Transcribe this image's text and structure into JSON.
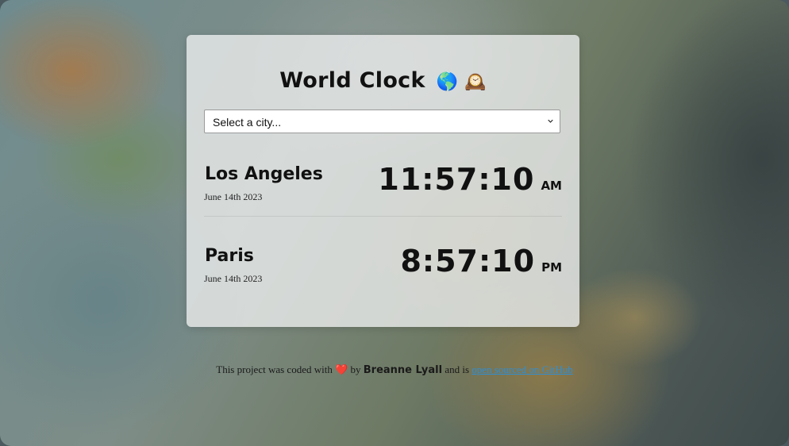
{
  "app": {
    "title": "World Clock",
    "title_emojis": "🌎 🕰️"
  },
  "city_select": {
    "value": "Select a city..."
  },
  "cities": [
    {
      "name": "Los Angeles",
      "date": "June 14th 2023",
      "time": "11:57:10",
      "period": "AM"
    },
    {
      "name": "Paris",
      "date": "June 14th 2023",
      "time": "8:57:10",
      "period": "PM"
    }
  ],
  "footer": {
    "text_before": "This project was coded with",
    "heart": "❤️",
    "by": "by",
    "author": "Breanne Lyall",
    "and_is": "and is",
    "link_text": "open sourced on GitHub"
  },
  "colors": {
    "link": "#2e8fd6",
    "card_bg": "rgba(238,240,240,0.78)"
  }
}
